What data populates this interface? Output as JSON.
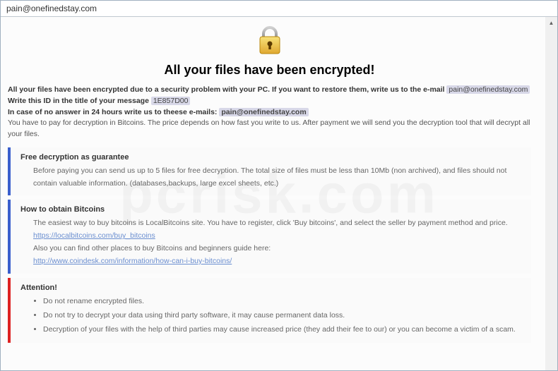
{
  "window": {
    "title": "pain@onefinedstay.com"
  },
  "header": {
    "heading": "All your files have been encrypted!"
  },
  "intro": {
    "line1a": "All your files have been encrypted due to a security problem with your PC. If you want to restore them, write us to the e-mail ",
    "email1": "pain@onefinedstay.com",
    "line2a": "Write this ID in the title of your message ",
    "id": "1E857D00",
    "line3a": "In case of no answer in 24 hours write us to theese e-mails: ",
    "email2": "pain@onefinedstay.com",
    "line4": "You have to pay for decryption in Bitcoins. The price depends on how fast you write to us. After payment we will send you the decryption tool that will decrypt all your files."
  },
  "guarantee": {
    "title": "Free decryption as guarantee",
    "body": "Before paying you can send us up to 5 files for free decryption. The total size of files must be less than 10Mb (non archived), and files should not contain valuable information. (databases,backups, large excel sheets, etc.)"
  },
  "howto": {
    "title": "How to obtain Bitcoins",
    "line1": "The easiest way to buy bitcoins is LocalBitcoins site. You have to register, click 'Buy bitcoins', and select the seller by payment method and price.",
    "link1": "https://localbitcoins.com/buy_bitcoins",
    "line2": "Also you can find other places to buy Bitcoins and beginners guide here:",
    "link2": "http://www.coindesk.com/information/how-can-i-buy-bitcoins/"
  },
  "attention": {
    "title": "Attention!",
    "items": [
      "Do not rename encrypted files.",
      "Do not try to decrypt your data using third party software, it may cause permanent data loss.",
      "Decryption of your files with the help of third parties may cause increased price (they add their fee to our) or you can become a victim of a scam."
    ]
  },
  "watermark": "pcrisk.com"
}
